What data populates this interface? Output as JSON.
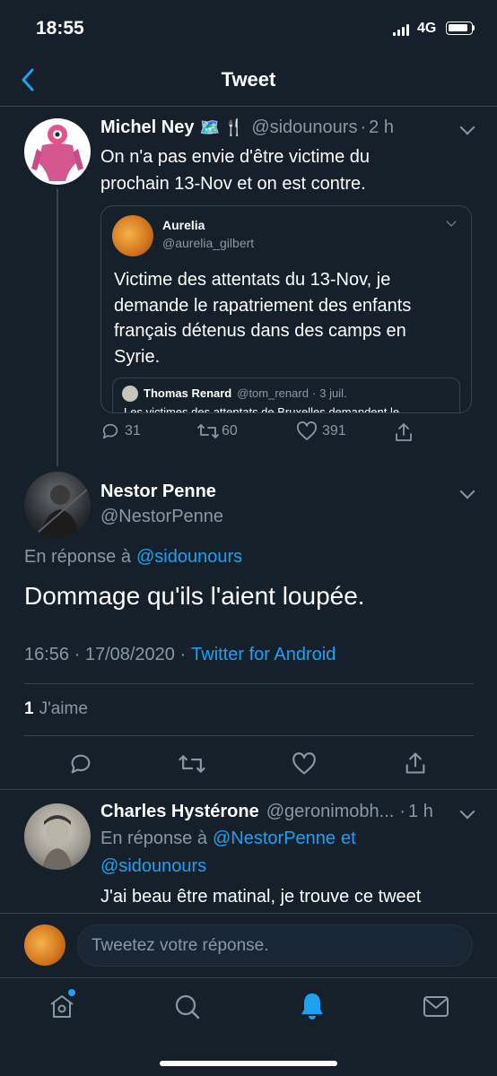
{
  "status_bar": {
    "time": "18:55",
    "network": "4G"
  },
  "header": {
    "title": "Tweet"
  },
  "tweet1": {
    "name": "Michel Ney",
    "emojis": "🗺️ 🍴",
    "handle": "@sidounours",
    "sep": "·",
    "time": "2 h",
    "text_line1": "On n'a pas envie d'être victime du",
    "text_line2": "prochain 13-Nov et on est contre.",
    "quote": {
      "name": "Aurelia",
      "handle": "@aurelia_gilbert",
      "text_line1": "Victime des attentats du 13-Nov, je",
      "text_line2": "demande le rapatriement des enfants",
      "text_line3": "français détenus dans des camps en",
      "text_line4": "Syrie.",
      "nested": {
        "name": "Thomas Renard",
        "handle": "@tom_renard",
        "sep": "·",
        "time": "3 juil.",
        "text": "Les victimes des attentats de Bruxelles demandent le"
      }
    },
    "replies": "31",
    "retweets": "60",
    "likes": "391"
  },
  "main_tweet": {
    "name": "Nestor Penne",
    "handle": "@NestorPenne",
    "reply_prefix": "En réponse à",
    "reply_to": "@sidounours",
    "text": "Dommage qu'ils l'aient loupée.",
    "timestamp": "16:56 · 17/08/2020 ·",
    "source": "Twitter for Android",
    "likes_count": "1",
    "likes_label": "J'aime"
  },
  "reply_tweet": {
    "name": "Charles Hystérone",
    "handle": "@geronimobh...",
    "sep": "·",
    "time": "1 h",
    "reply_prefix": "En réponse à",
    "reply_to1": "@NestorPenne",
    "reply_and": "et",
    "reply_to2": "@sidounours",
    "text": "J'ai beau être matinal, je trouve ce tweet"
  },
  "composer": {
    "placeholder": "Tweetez votre réponse."
  },
  "tab_bar": {
    "items": [
      "home-icon",
      "search-icon",
      "notifications-icon",
      "messages-icon"
    ],
    "active": "notifications-icon"
  },
  "colors": {
    "background": "#15202b",
    "accent": "#1da1f2",
    "muted": "#8899a6",
    "divider": "#38444d"
  }
}
